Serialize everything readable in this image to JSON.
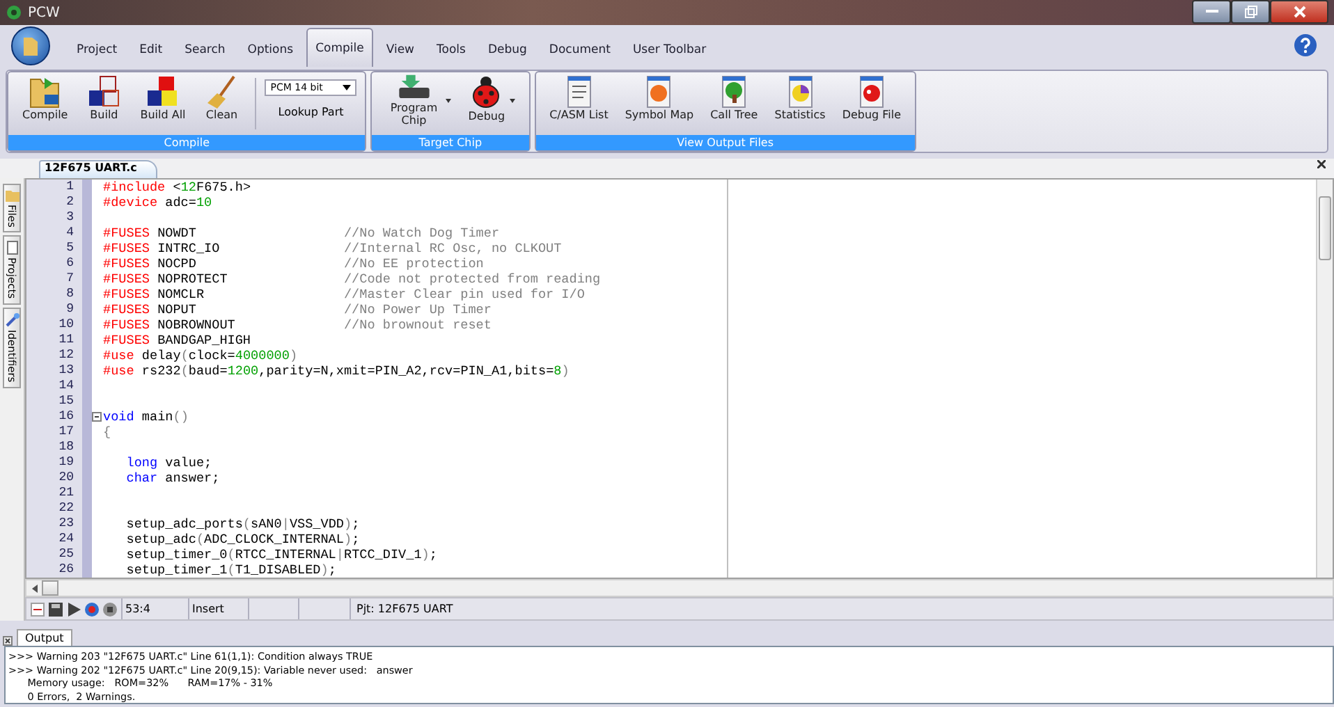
{
  "window": {
    "title": "PCW"
  },
  "menu": [
    {
      "label": "Project",
      "selected": false
    },
    {
      "label": "Edit",
      "selected": false
    },
    {
      "label": "Search",
      "selected": false
    },
    {
      "label": "Options",
      "selected": false
    },
    {
      "label": "Compile",
      "selected": true
    },
    {
      "label": "View",
      "selected": false
    },
    {
      "label": "Tools",
      "selected": false
    },
    {
      "label": "Debug",
      "selected": false
    },
    {
      "label": "Document",
      "selected": false
    },
    {
      "label": "User Toolbar",
      "selected": false
    }
  ],
  "ribbon": [
    {
      "title": "Compile",
      "items": [
        {
          "kind": "compile",
          "label": "Compile"
        },
        {
          "kind": "build",
          "label": "Build"
        },
        {
          "kind": "buildall",
          "label": "Build All"
        },
        {
          "kind": "clean",
          "label": "Clean"
        },
        {
          "kind": "select",
          "value": "PCM 14 bit",
          "label": "Lookup Part"
        }
      ]
    },
    {
      "title": "Target Chip",
      "items": [
        {
          "kind": "chip",
          "label": "Program Chip",
          "dropdown": true
        },
        {
          "kind": "bug",
          "label": "Debug",
          "dropdown": true
        }
      ]
    },
    {
      "title": "View Output Files",
      "items": [
        {
          "kind": "list",
          "label": "C/ASM List"
        },
        {
          "kind": "symbol",
          "label": "Symbol Map"
        },
        {
          "kind": "tree",
          "label": "Call Tree"
        },
        {
          "kind": "stats",
          "label": "Statistics"
        },
        {
          "kind": "debugfile",
          "label": "Debug File"
        }
      ]
    }
  ],
  "file_tab": {
    "label": "12F675 UART.c",
    "selected": true
  },
  "side_tabs": [
    {
      "label": "Files",
      "kind": "folder"
    },
    {
      "label": "Projects",
      "kind": "page"
    },
    {
      "label": "Identifiers",
      "kind": "wand"
    }
  ],
  "code": [
    {
      "number": "1",
      "indent": false,
      "tokens": [
        {
          "kind": "directive",
          "text": "#include"
        },
        {
          "kind": "plain",
          "text": " <"
        },
        {
          "kind": "number",
          "text": "12"
        },
        {
          "kind": "plain",
          "text": "F675.h>"
        }
      ]
    },
    {
      "number": "2",
      "indent": false,
      "tokens": [
        {
          "kind": "directive",
          "text": "#device"
        },
        {
          "kind": "plain",
          "text": " adc="
        },
        {
          "kind": "number",
          "text": "10"
        }
      ]
    },
    {
      "number": "3"
    },
    {
      "number": "4",
      "indent": false,
      "tokens": [
        {
          "kind": "directive",
          "text": "#FUSES"
        },
        {
          "kind": "plain",
          "text": " NOWDT                   "
        },
        {
          "kind": "comment",
          "text": "//No Watch Dog Timer"
        }
      ]
    },
    {
      "number": "5",
      "indent": false,
      "tokens": [
        {
          "kind": "directive",
          "text": "#FUSES"
        },
        {
          "kind": "plain",
          "text": " INTRC_IO                "
        },
        {
          "kind": "comment",
          "text": "//Internal RC Osc, no CLKOUT"
        }
      ]
    },
    {
      "number": "6",
      "indent": false,
      "tokens": [
        {
          "kind": "directive",
          "text": "#FUSES"
        },
        {
          "kind": "plain",
          "text": " NOCPD                   "
        },
        {
          "kind": "comment",
          "text": "//No EE protection"
        }
      ]
    },
    {
      "number": "7",
      "indent": false,
      "tokens": [
        {
          "kind": "directive",
          "text": "#FUSES"
        },
        {
          "kind": "plain",
          "text": " NOPROTECT               "
        },
        {
          "kind": "comment",
          "text": "//Code not protected from reading"
        }
      ]
    },
    {
      "number": "8",
      "indent": false,
      "tokens": [
        {
          "kind": "directive",
          "text": "#FUSES"
        },
        {
          "kind": "plain",
          "text": " NOMCLR                  "
        },
        {
          "kind": "comment",
          "text": "//Master Clear pin used for I/O"
        }
      ]
    },
    {
      "number": "9",
      "indent": false,
      "tokens": [
        {
          "kind": "directive",
          "text": "#FUSES"
        },
        {
          "kind": "plain",
          "text": " NOPUT                   "
        },
        {
          "kind": "comment",
          "text": "//No Power Up Timer"
        }
      ]
    },
    {
      "number": "10",
      "indent": false,
      "tokens": [
        {
          "kind": "directive",
          "text": "#FUSES"
        },
        {
          "kind": "plain",
          "text": " NOBROWNOUT              "
        },
        {
          "kind": "comment",
          "text": "//No brownout reset"
        }
      ]
    },
    {
      "number": "11",
      "indent": false,
      "tokens": [
        {
          "kind": "directive",
          "text": "#FUSES"
        },
        {
          "kind": "plain",
          "text": " BANDGAP_HIGH"
        }
      ]
    },
    {
      "number": "12",
      "indent": false,
      "tokens": [
        {
          "kind": "directive",
          "text": "#use"
        },
        {
          "kind": "plain",
          "text": " delay"
        },
        {
          "kind": "punct",
          "text": "("
        },
        {
          "kind": "plain",
          "text": "clock="
        },
        {
          "kind": "number",
          "text": "4000000"
        },
        {
          "kind": "punct",
          "text": ")"
        }
      ]
    },
    {
      "number": "13",
      "indent": false,
      "tokens": [
        {
          "kind": "directive",
          "text": "#use"
        },
        {
          "kind": "plain",
          "text": " rs232"
        },
        {
          "kind": "punct",
          "text": "("
        },
        {
          "kind": "plain",
          "text": "baud="
        },
        {
          "kind": "number",
          "text": "1200"
        },
        {
          "kind": "plain",
          "text": ",parity=N,xmit=PIN_A2,rcv=PIN_A1,bits="
        },
        {
          "kind": "number",
          "text": "8"
        },
        {
          "kind": "punct",
          "text": ")"
        }
      ]
    },
    {
      "number": "14"
    },
    {
      "number": "15"
    },
    {
      "number": "16",
      "indent": false,
      "tokens": [
        {
          "kind": "keyword",
          "text": "void"
        },
        {
          "kind": "plain",
          "text": " main"
        },
        {
          "kind": "punct",
          "text": "()"
        }
      ]
    },
    {
      "number": "17",
      "indent": false,
      "tokens": [
        {
          "kind": "punct",
          "text": "{"
        }
      ]
    },
    {
      "number": "18"
    },
    {
      "number": "19",
      "indent": true,
      "tokens": [
        {
          "kind": "keyword",
          "text": "long"
        },
        {
          "kind": "plain",
          "text": " value;"
        }
      ]
    },
    {
      "number": "20",
      "indent": true,
      "tokens": [
        {
          "kind": "keyword",
          "text": "char"
        },
        {
          "kind": "plain",
          "text": " answer;"
        }
      ]
    },
    {
      "number": "21"
    },
    {
      "number": "22"
    },
    {
      "number": "23",
      "indent": true,
      "tokens": [
        {
          "kind": "plain",
          "text": "setup_adc_ports"
        },
        {
          "kind": "punct",
          "text": "("
        },
        {
          "kind": "plain",
          "text": "sAN0"
        },
        {
          "kind": "punct",
          "text": "|"
        },
        {
          "kind": "plain",
          "text": "VSS_VDD"
        },
        {
          "kind": "punct",
          "text": ")"
        },
        {
          "kind": "plain",
          "text": ";"
        }
      ]
    },
    {
      "number": "24",
      "indent": true,
      "tokens": [
        {
          "kind": "plain",
          "text": "setup_adc"
        },
        {
          "kind": "punct",
          "text": "("
        },
        {
          "kind": "plain",
          "text": "ADC_CLOCK_INTERNAL"
        },
        {
          "kind": "punct",
          "text": ")"
        },
        {
          "kind": "plain",
          "text": ";"
        }
      ]
    },
    {
      "number": "25",
      "indent": true,
      "tokens": [
        {
          "kind": "plain",
          "text": "setup_timer_0"
        },
        {
          "kind": "punct",
          "text": "("
        },
        {
          "kind": "plain",
          "text": "RTCC_INTERNAL"
        },
        {
          "kind": "punct",
          "text": "|"
        },
        {
          "kind": "plain",
          "text": "RTCC_DIV_1"
        },
        {
          "kind": "punct",
          "text": ")"
        },
        {
          "kind": "plain",
          "text": ";"
        }
      ]
    },
    {
      "number": "26",
      "indent": true,
      "tokens": [
        {
          "kind": "plain",
          "text": "setup_timer_1"
        },
        {
          "kind": "punct",
          "text": "("
        },
        {
          "kind": "plain",
          "text": "T1_DISABLED"
        },
        {
          "kind": "punct",
          "text": ")"
        },
        {
          "kind": "plain",
          "text": ";"
        }
      ]
    }
  ],
  "status_bar": {
    "position": "53:4",
    "mode": "Insert",
    "project": "Pjt: 12F675 UART"
  },
  "output": {
    "tab": {
      "label": "Output",
      "selected": true
    },
    "lines": [
      ">>> Warning 203 \"12F675 UART.c\" Line 61(1,1): Condition always TRUE",
      ">>> Warning 202 \"12F675 UART.c\" Line 20(9,15): Variable never used:   answer",
      "      Memory usage:   ROM=32%      RAM=17% - 31%",
      "      0 Errors,  2 Warnings."
    ]
  }
}
